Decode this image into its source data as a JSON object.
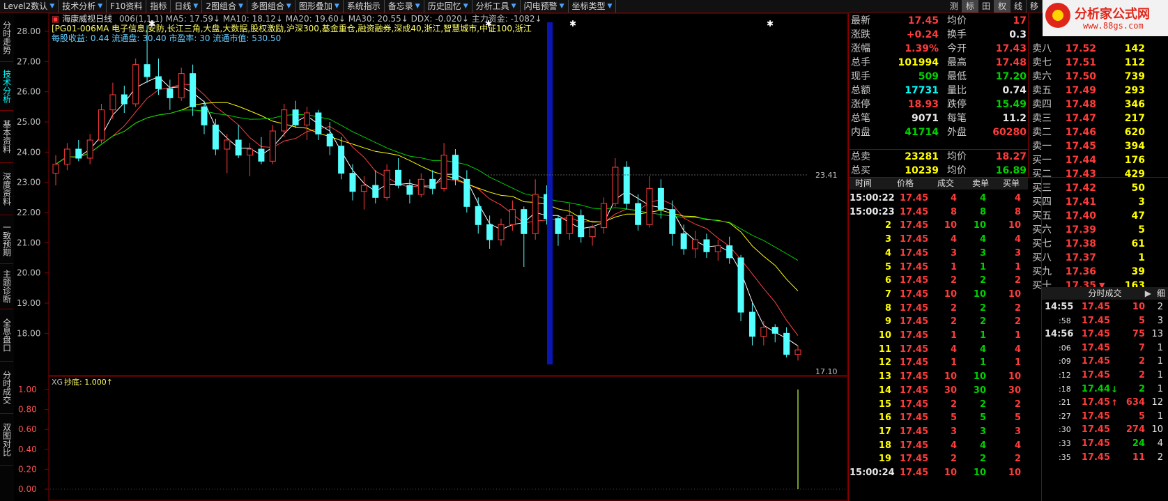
{
  "toolbar": {
    "items": [
      "Level2数认",
      "技术分析",
      "F10资料",
      "指标",
      "日线",
      "2图组合",
      "多图组合",
      "图形叠加",
      "系统指示",
      "备忘录",
      "历史回忆",
      "分析工具",
      "闪电预警",
      "坐标类型"
    ],
    "right_buttons": [
      "测",
      "标",
      "田",
      "权",
      "线",
      "移"
    ]
  },
  "sidebar": [
    "分时走势",
    "技术分析",
    "基本资料",
    "深度资料",
    "一致预期",
    "主题诊断",
    "全息盘口",
    "分时成交",
    "双图对比"
  ],
  "chart": {
    "stock_name": "海康威视日线",
    "ma_line": "006(1,1,1) MA5: 17.59↓ MA10: 18.12↓ MA20: 19.60↓ MA30: 20.55↓ DDX: -0.020↓ 主力资金: -1082↓",
    "concept_line": "[PG01-006MA 电子信息,安防,长江三角,大盘,大数据,股权激励,沪深300,基金重仓,融资融券,深成40,浙江,智慧城市,中证100,浙江",
    "info_line": "每股收益: 0.44 流通盘: 30.40 市盈率: 30 流通市值: 530.50",
    "y_ticks": [
      "28.00",
      "27.00",
      "26.00",
      "25.00",
      "24.00",
      "23.00",
      "22.00",
      "21.00",
      "20.00",
      "19.00",
      "18.00"
    ],
    "high_label": "23.41",
    "low_label": "17.10",
    "sub_label": "XG",
    "sub_title": "抄底: 1.000↑",
    "sub_ticks": [
      "1.00",
      "0.80",
      "0.60",
      "0.40",
      "0.20",
      "0.00"
    ]
  },
  "chart_data": {
    "type": "candlestick",
    "ylim": [
      17,
      28.5
    ],
    "ma_series": [
      "MA5",
      "MA10",
      "MA20",
      "MA30"
    ],
    "candles_ohlc": [
      [
        23.3,
        23.9,
        22.9,
        23.6
      ],
      [
        23.6,
        24.3,
        23.4,
        24.1
      ],
      [
        24.1,
        24.4,
        23.7,
        23.8
      ],
      [
        23.8,
        24.6,
        23.6,
        24.4
      ],
      [
        24.4,
        25.6,
        24.3,
        25.4
      ],
      [
        25.4,
        26.3,
        25.1,
        25.9
      ],
      [
        25.9,
        26.2,
        25.3,
        25.6
      ],
      [
        25.6,
        27.1,
        25.5,
        26.9
      ],
      [
        26.9,
        28.2,
        26.3,
        26.5
      ],
      [
        26.5,
        27.1,
        25.9,
        26.1
      ],
      [
        26.1,
        26.4,
        25.4,
        25.8
      ],
      [
        25.8,
        26.8,
        25.7,
        26.6
      ],
      [
        26.6,
        26.9,
        25.2,
        25.5
      ],
      [
        25.5,
        25.7,
        24.6,
        24.9
      ],
      [
        24.9,
        25.1,
        23.9,
        24.1
      ],
      [
        24.1,
        24.6,
        23.3,
        24.4
      ],
      [
        24.4,
        24.9,
        23.8,
        23.9
      ],
      [
        23.9,
        24.3,
        23.2,
        24.1
      ],
      [
        24.1,
        24.5,
        23.6,
        23.7
      ],
      [
        23.7,
        24.9,
        23.6,
        24.7
      ],
      [
        24.7,
        25.6,
        24.5,
        25.4
      ],
      [
        25.4,
        25.7,
        24.8,
        24.9
      ],
      [
        24.9,
        25.5,
        24.4,
        25.3
      ],
      [
        25.3,
        25.4,
        24.4,
        24.6
      ],
      [
        24.6,
        25.0,
        23.9,
        24.2
      ],
      [
        24.2,
        24.5,
        23.1,
        23.3
      ],
      [
        23.3,
        23.6,
        22.4,
        22.7
      ],
      [
        22.7,
        23.2,
        22.1,
        22.9
      ],
      [
        22.9,
        23.4,
        22.3,
        22.5
      ],
      [
        22.5,
        23.6,
        22.4,
        23.4
      ],
      [
        23.4,
        23.8,
        22.8,
        22.9
      ],
      [
        22.9,
        23.1,
        22.3,
        22.6
      ],
      [
        22.6,
        23.3,
        22.5,
        23.1
      ],
      [
        23.1,
        23.4,
        22.6,
        22.8
      ],
      [
        22.8,
        24.3,
        22.7,
        23.9
      ],
      [
        23.9,
        24.1,
        22.9,
        23.1
      ],
      [
        23.1,
        23.4,
        22.0,
        22.2
      ],
      [
        22.2,
        22.5,
        21.3,
        21.6
      ],
      [
        21.6,
        21.9,
        20.8,
        21.1
      ],
      [
        21.1,
        21.8,
        20.9,
        21.6
      ],
      [
        21.6,
        22.4,
        21.4,
        22.1
      ],
      [
        22.1,
        22.2,
        20.2,
        21.3
      ],
      [
        21.3,
        23.1,
        21.1,
        22.6
      ],
      [
        22.6,
        22.9,
        21.6,
        21.8
      ],
      [
        21.8,
        21.9,
        20.9,
        21.3
      ],
      [
        21.3,
        22.3,
        21.1,
        21.9
      ],
      [
        21.9,
        22.1,
        21.0,
        21.2
      ],
      [
        21.2,
        21.6,
        20.9,
        21.5
      ],
      [
        21.5,
        22.5,
        21.3,
        22.3
      ],
      [
        22.3,
        23.8,
        22.2,
        23.5
      ],
      [
        23.5,
        23.7,
        22.1,
        22.3
      ],
      [
        22.3,
        22.6,
        21.4,
        21.6
      ],
      [
        21.6,
        23.2,
        21.5,
        22.8
      ],
      [
        22.8,
        23.1,
        21.8,
        22.1
      ],
      [
        22.1,
        22.4,
        20.9,
        21.3
      ],
      [
        21.3,
        21.6,
        20.6,
        20.8
      ],
      [
        20.8,
        21.4,
        20.5,
        21.1
      ],
      [
        21.1,
        21.3,
        20.5,
        20.7
      ],
      [
        20.7,
        21.1,
        20.4,
        20.9
      ],
      [
        20.9,
        21.2,
        20.3,
        20.5
      ],
      [
        20.5,
        20.6,
        18.4,
        18.7
      ],
      [
        18.7,
        19.0,
        17.6,
        17.9
      ],
      [
        17.9,
        18.4,
        17.6,
        18.2
      ],
      [
        18.2,
        18.3,
        17.7,
        18.0
      ],
      [
        18.0,
        18.2,
        17.2,
        17.3
      ],
      [
        17.3,
        17.6,
        17.1,
        17.45
      ]
    ],
    "xg_signal_index": 65,
    "xg_signal_value": 1.0
  },
  "quote": {
    "left": [
      {
        "label": "最新",
        "value": "17.45",
        "color": "red"
      },
      {
        "label": "涨跌",
        "value": "+0.24",
        "color": "red"
      },
      {
        "label": "涨幅",
        "value": "1.39%",
        "color": "red"
      },
      {
        "label": "总手",
        "value": "101994",
        "color": "yellow"
      },
      {
        "label": "现手",
        "value": "509",
        "color": "green"
      },
      {
        "label": "总额",
        "value": "17731",
        "color": "cyan"
      },
      {
        "label": "涨停",
        "value": "18.93",
        "color": "red"
      },
      {
        "label": "总笔",
        "value": "9071",
        "color": "white"
      },
      {
        "label": "内盘",
        "value": "41714",
        "color": "green"
      }
    ],
    "mid": [
      {
        "label": "均价",
        "value": "17",
        "color": "red"
      },
      {
        "label": "换手",
        "value": "0.3",
        "color": "white"
      },
      {
        "label": "今开",
        "value": "17.43",
        "color": "red"
      },
      {
        "label": "最高",
        "value": "17.48",
        "color": "red"
      },
      {
        "label": "最低",
        "value": "17.20",
        "color": "green"
      },
      {
        "label": "量比",
        "value": "0.74",
        "color": "white"
      },
      {
        "label": "跌停",
        "value": "15.49",
        "color": "green"
      },
      {
        "label": "每笔",
        "value": "11.2",
        "color": "white"
      },
      {
        "label": "外盘",
        "value": "60280",
        "color": "red"
      }
    ],
    "sell_total": {
      "label": "总卖",
      "value": "23281",
      "avg_label": "均价",
      "avg": "18.27"
    },
    "buy_total": {
      "label": "总买",
      "value": "10239",
      "avg_label": "均价",
      "avg": "16.89"
    },
    "asks": [
      {
        "label": "卖八",
        "price": "17.52",
        "vol": "142"
      },
      {
        "label": "卖七",
        "price": "17.51",
        "vol": "112"
      },
      {
        "label": "卖六",
        "price": "17.50",
        "vol": "739"
      },
      {
        "label": "卖五",
        "price": "17.49",
        "vol": "293"
      },
      {
        "label": "卖四",
        "price": "17.48",
        "vol": "346"
      },
      {
        "label": "卖三",
        "price": "17.47",
        "vol": "217"
      },
      {
        "label": "卖二",
        "price": "17.46",
        "vol": "620"
      },
      {
        "label": "卖一",
        "price": "17.45",
        "vol": "394"
      }
    ],
    "bids": [
      {
        "label": "买一",
        "price": "17.44",
        "vol": "176"
      },
      {
        "label": "买二",
        "price": "17.43",
        "vol": "429"
      },
      {
        "label": "买三",
        "price": "17.42",
        "vol": "50"
      },
      {
        "label": "买四",
        "price": "17.41",
        "vol": "3"
      },
      {
        "label": "买五",
        "price": "17.40",
        "vol": "47"
      },
      {
        "label": "买六",
        "price": "17.39",
        "vol": "5"
      },
      {
        "label": "买七",
        "price": "17.38",
        "vol": "61"
      },
      {
        "label": "买八",
        "price": "17.37",
        "vol": "1"
      },
      {
        "label": "买九",
        "price": "17.36",
        "vol": "39"
      },
      {
        "label": "买十",
        "price": "17.35",
        "vol": "163",
        "arrow": "▼"
      }
    ]
  },
  "ticks": {
    "headers": [
      "时间",
      "价格",
      "成交",
      "卖单",
      "买单"
    ],
    "rows": [
      [
        "15:00:22",
        "17.45",
        "4",
        "4",
        "4"
      ],
      [
        "15:00:23",
        "17.45",
        "8",
        "8",
        "8"
      ],
      [
        "2",
        "17.45",
        "10",
        "10",
        "10"
      ],
      [
        "3",
        "17.45",
        "4",
        "4",
        "4"
      ],
      [
        "4",
        "17.45",
        "3",
        "3",
        "3"
      ],
      [
        "5",
        "17.45",
        "1",
        "1",
        "1"
      ],
      [
        "6",
        "17.45",
        "2",
        "2",
        "2"
      ],
      [
        "7",
        "17.45",
        "10",
        "10",
        "10"
      ],
      [
        "8",
        "17.45",
        "2",
        "2",
        "2"
      ],
      [
        "9",
        "17.45",
        "2",
        "2",
        "2"
      ],
      [
        "10",
        "17.45",
        "1",
        "1",
        "1"
      ],
      [
        "11",
        "17.45",
        "4",
        "4",
        "4"
      ],
      [
        "12",
        "17.45",
        "1",
        "1",
        "1"
      ],
      [
        "13",
        "17.45",
        "10",
        "10",
        "10"
      ],
      [
        "14",
        "17.45",
        "30",
        "30",
        "30"
      ],
      [
        "15",
        "17.45",
        "2",
        "2",
        "2"
      ],
      [
        "16",
        "17.45",
        "5",
        "5",
        "5"
      ],
      [
        "17",
        "17.45",
        "3",
        "3",
        "3"
      ],
      [
        "18",
        "17.45",
        "4",
        "4",
        "4"
      ],
      [
        "19",
        "17.45",
        "2",
        "2",
        "2"
      ],
      [
        "15:00:24",
        "17.45",
        "10",
        "10",
        "10"
      ]
    ]
  },
  "fenshi": {
    "title": "分时成交",
    "detail": "细",
    "rows": [
      [
        "14:55",
        "17.45",
        "10",
        "2",
        ""
      ],
      [
        ":58",
        "17.45",
        "5",
        "3",
        ""
      ],
      [
        "14:56",
        "17.45",
        "75",
        "13",
        ""
      ],
      [
        ":06",
        "17.45",
        "7",
        "1",
        ""
      ],
      [
        ":09",
        "17.45",
        "2",
        "1",
        ""
      ],
      [
        ":12",
        "17.45",
        "2",
        "1",
        ""
      ],
      [
        ":18",
        "17.44",
        "2",
        "1",
        "↓"
      ],
      [
        ":21",
        "17.45",
        "634",
        "12",
        "↑"
      ],
      [
        ":27",
        "17.45",
        "5",
        "1",
        ""
      ],
      [
        ":30",
        "17.45",
        "274",
        "10",
        ""
      ],
      [
        ":33",
        "17.45",
        "24",
        "4",
        ""
      ],
      [
        ":35",
        "17.45",
        "11",
        "2",
        ""
      ]
    ]
  },
  "watermark": {
    "title": "分析家公式网",
    "url": "www.88gs.com"
  }
}
